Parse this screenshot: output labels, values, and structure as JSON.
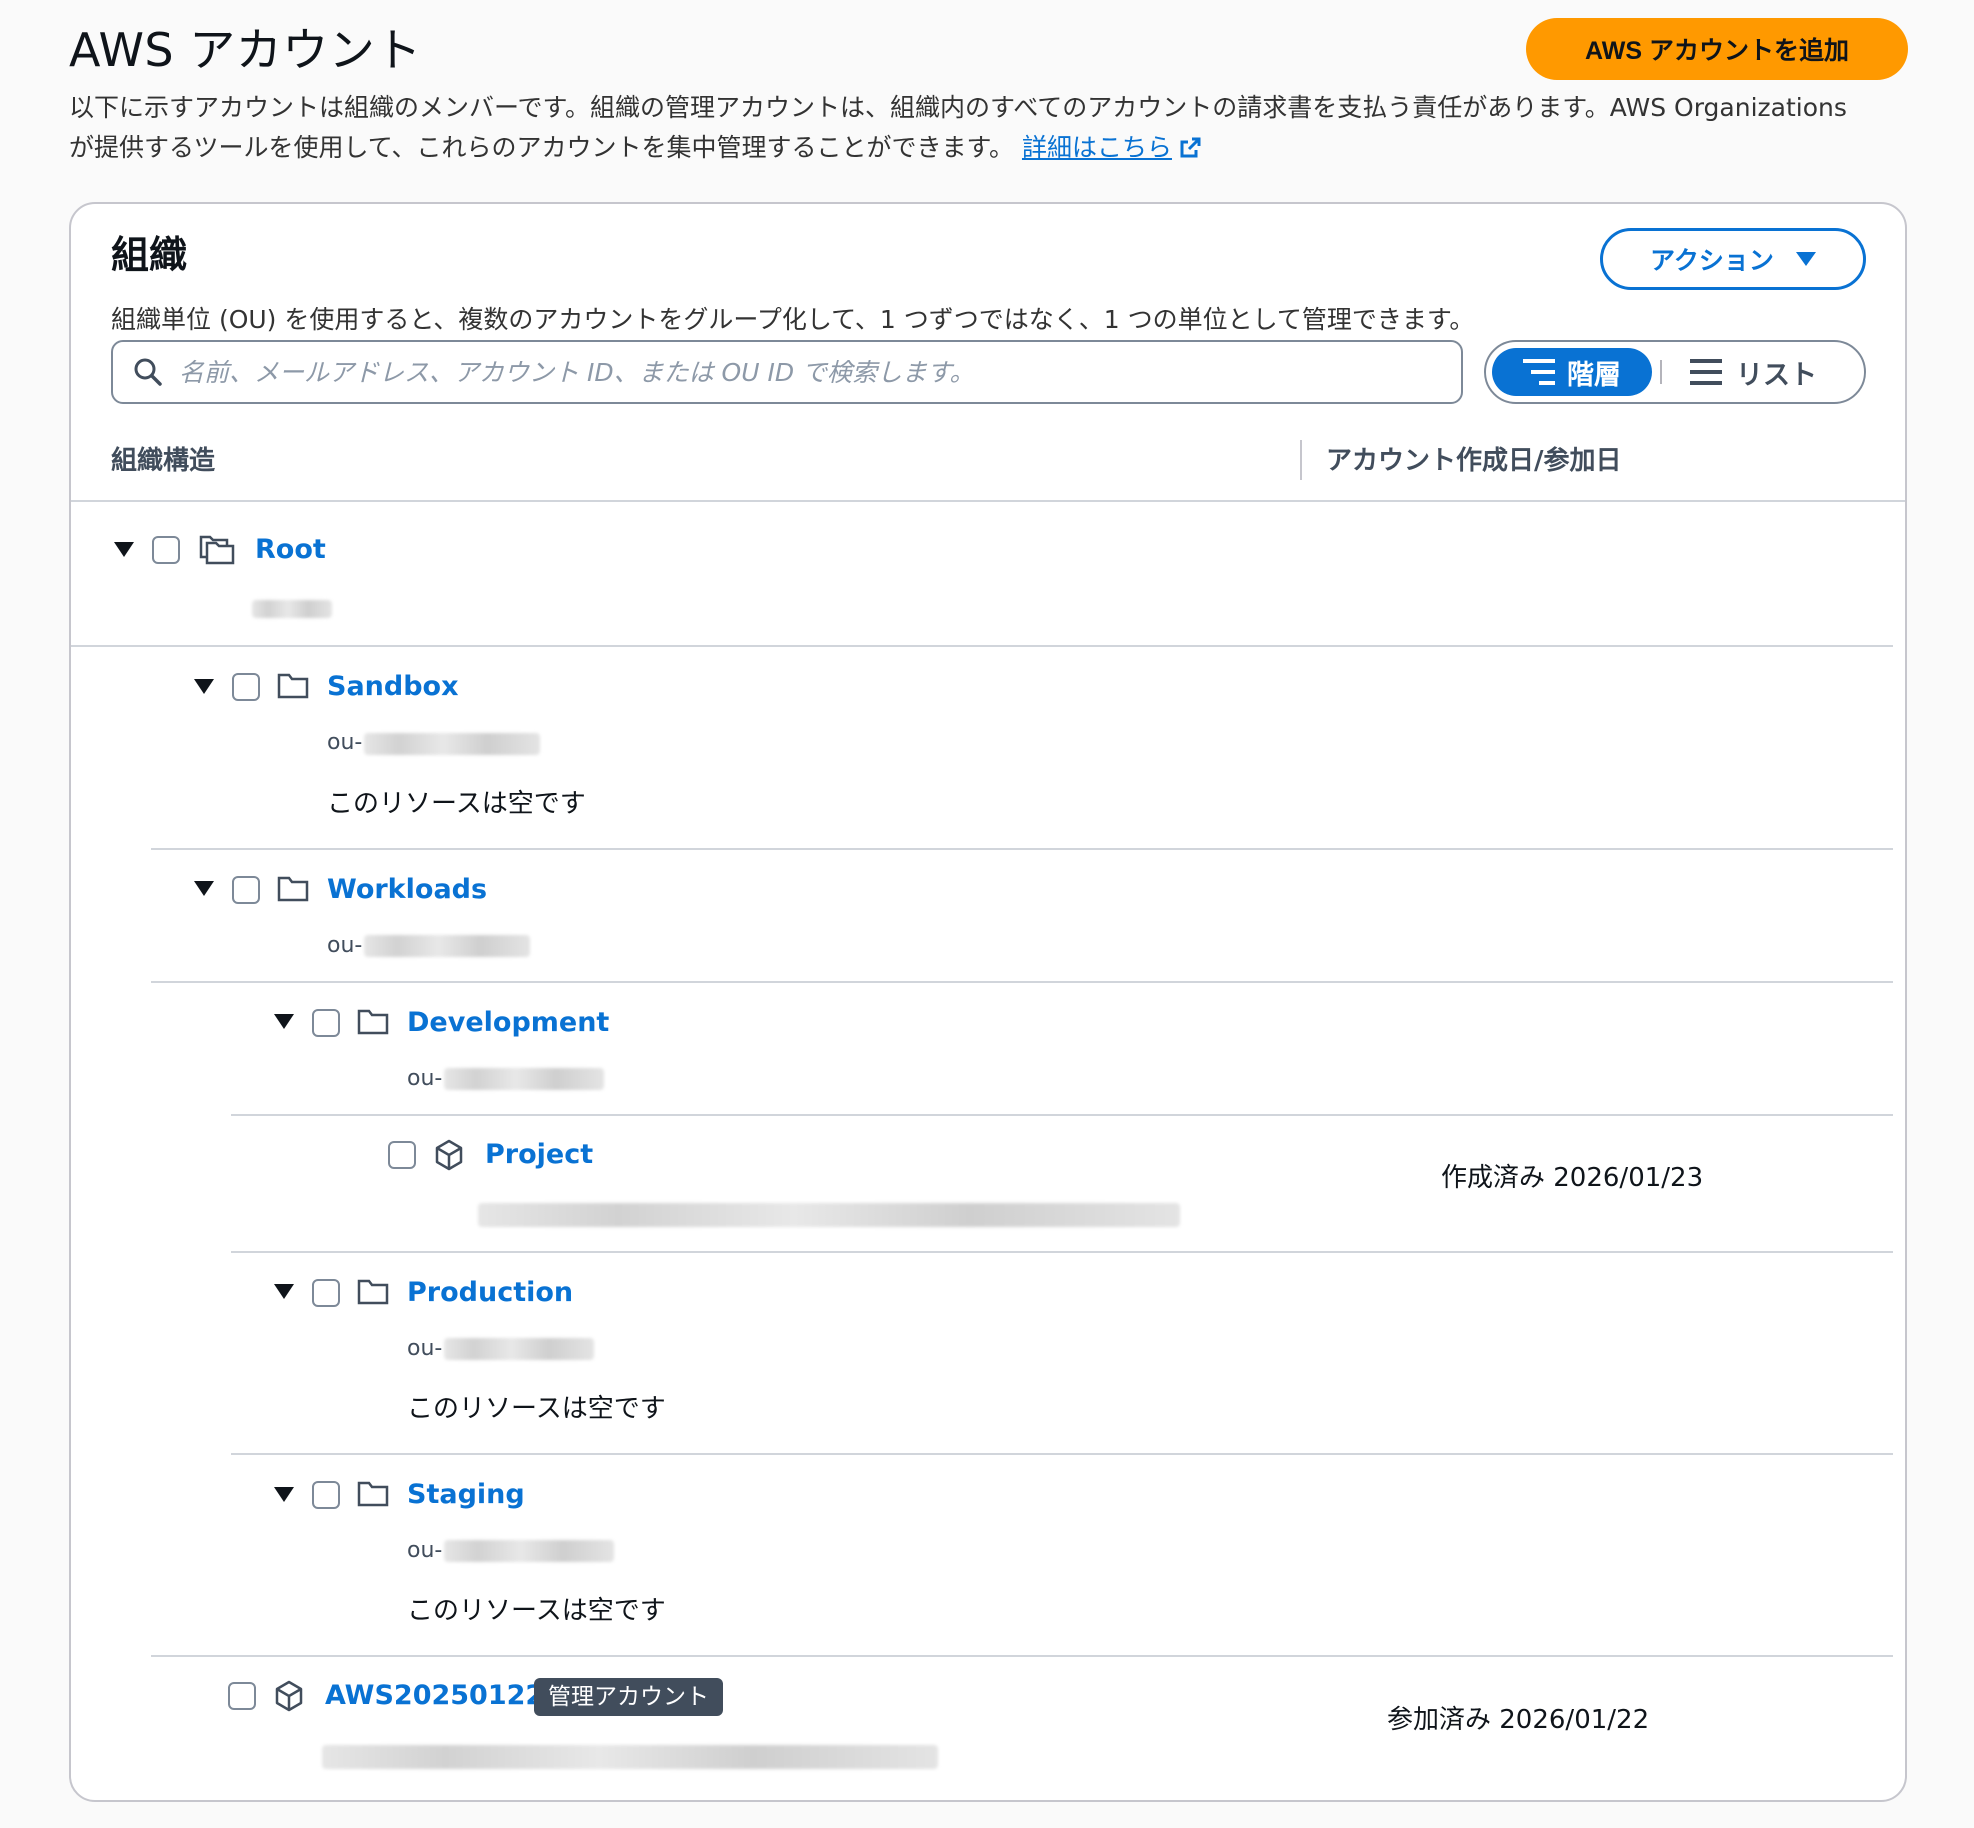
{
  "header": {
    "title": "AWS アカウント",
    "add_account_label": "AWS アカウントを追加",
    "description": "以下に示すアカウントは組織のメンバーです。組織の管理アカウントは、組織内のすべてのアカウントの請求書を支払う責任があります。AWS Organizations が提供するツールを使用して、これらのアカウントを集中管理することができます。",
    "learn_more_label": "詳細はこちら"
  },
  "org": {
    "title": "組織",
    "actions_label": "アクション",
    "description": "組織単位 (OU) を使用すると、複数のアカウントをグループ化して、1 つずつではなく、1 つの単位として管理できます。",
    "search_placeholder": "名前、メールアドレス、アカウント ID、または OU ID で検索します。",
    "view_toggle": {
      "hierarchy_label": "階層",
      "list_label": "リスト",
      "selected": "hierarchy"
    },
    "columns": {
      "structure": "組織構造",
      "date": "アカウント作成日/参加日"
    }
  },
  "tree": {
    "root": {
      "name": "Root"
    },
    "sandbox": {
      "name": "Sandbox",
      "id_prefix": "ou-",
      "empty": "このリソースは空です"
    },
    "workloads": {
      "name": "Workloads",
      "id_prefix": "ou-"
    },
    "development": {
      "name": "Development",
      "id_prefix": "ou-"
    },
    "project": {
      "name": "Project",
      "date": "作成済み 2026/01/23"
    },
    "production": {
      "name": "Production",
      "id_prefix": "ou-",
      "empty": "このリソースは空です"
    },
    "staging": {
      "name": "Staging",
      "id_prefix": "ou-",
      "empty": "このリソースは空です"
    },
    "management": {
      "name": "AWS20250122",
      "badge": "管理アカウント",
      "date": "参加済み 2026/01/22"
    }
  },
  "colors": {
    "accent": "#0972d3",
    "primary_button": "#ff9900",
    "badge_bg": "#414d5c"
  }
}
